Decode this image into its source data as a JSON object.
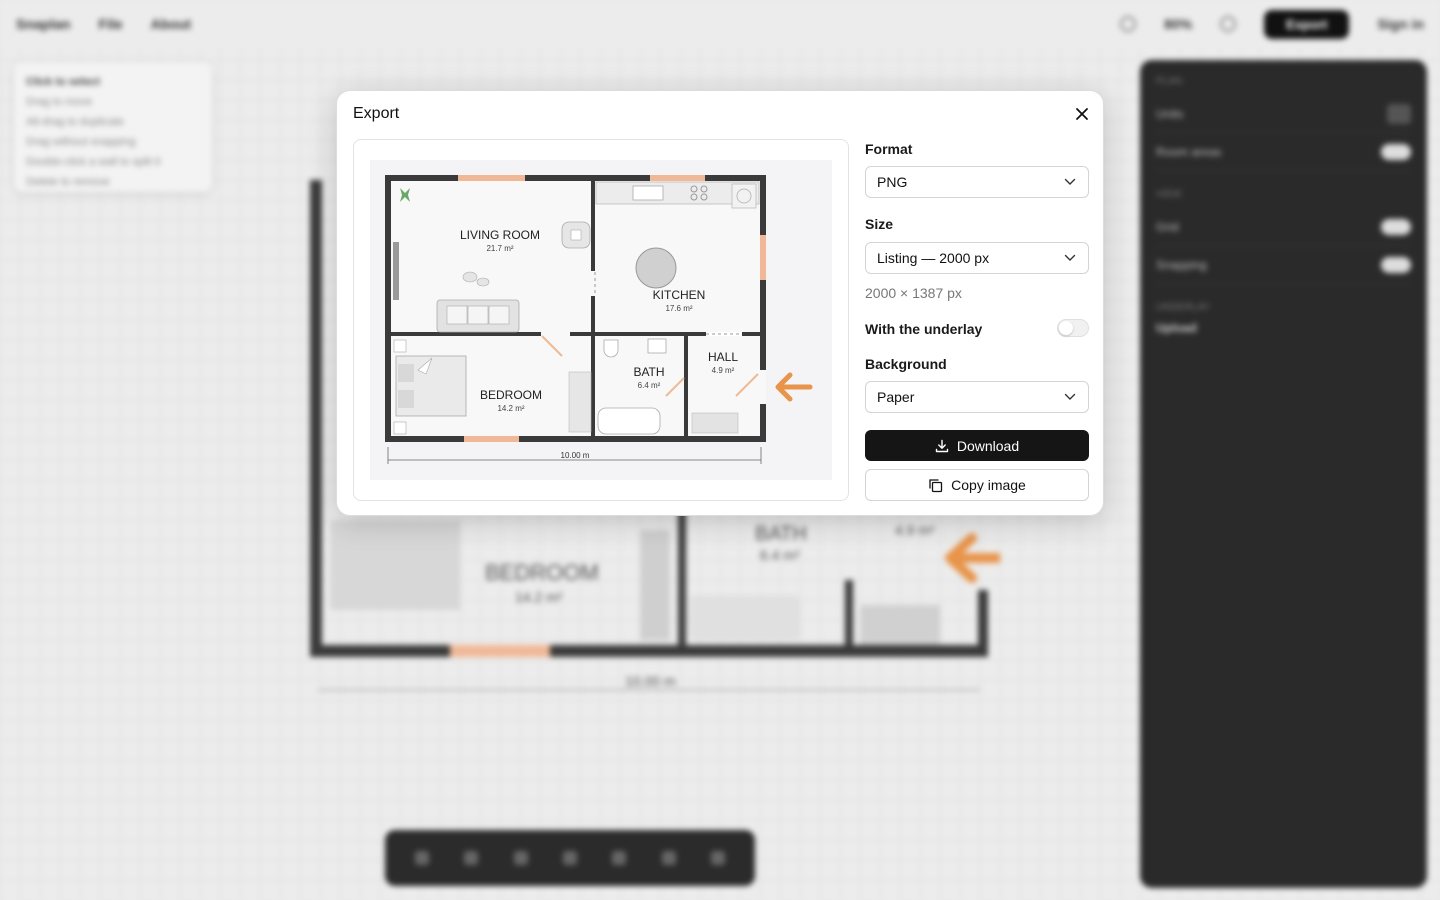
{
  "background": {
    "app_name": "Snaplan",
    "menu_file": "File",
    "menu_about": "About",
    "zoom": "80%",
    "export_label": "Export",
    "sign_in": "Sign in",
    "hints": [
      "Click to select",
      "Drag to move",
      "Alt-drag to duplicate",
      "Drag without snapping",
      "Double-click a wall to split it",
      "Delete to remove"
    ],
    "panel_section": "PLAN",
    "panel_rows": [
      "Units",
      "Room areas"
    ],
    "panel_section2": "VIEW",
    "panel_rows2": [
      "Grid",
      "Snapping"
    ],
    "panel_section3": "UNDERLAY",
    "panel_upload": "Upload",
    "room_bedroom": "BEDROOM",
    "room_bedroom_area": "14.2 m²",
    "room_bath": "BATH",
    "room_bath_area": "6.4 m²",
    "room_hall_area": "4.9 m²",
    "dimension": "10.00 m"
  },
  "modal": {
    "title": "Export",
    "format": {
      "label": "Format",
      "value": "PNG"
    },
    "size": {
      "label": "Size",
      "value": "Listing — 2000 px",
      "dimensions": "2000 × 1387 px"
    },
    "underlay": {
      "label": "With the underlay",
      "enabled": false
    },
    "background": {
      "label": "Background",
      "value": "Paper"
    },
    "download_label": "Download",
    "copy_label": "Copy image"
  },
  "plan": {
    "rooms": [
      {
        "name": "LIVING ROOM",
        "area": "21.7 m²"
      },
      {
        "name": "KITCHEN",
        "area": "17.6 m²"
      },
      {
        "name": "BEDROOM",
        "area": "14.2 m²"
      },
      {
        "name": "BATH",
        "area": "6.4 m²"
      },
      {
        "name": "HALL",
        "area": "4.9 m²"
      }
    ],
    "dimension": "10.00 m"
  },
  "colors": {
    "wall": "#3a3a3a",
    "window": "#f0b896",
    "accent_arrow": "#e8944a",
    "primary_button": "#151515"
  }
}
